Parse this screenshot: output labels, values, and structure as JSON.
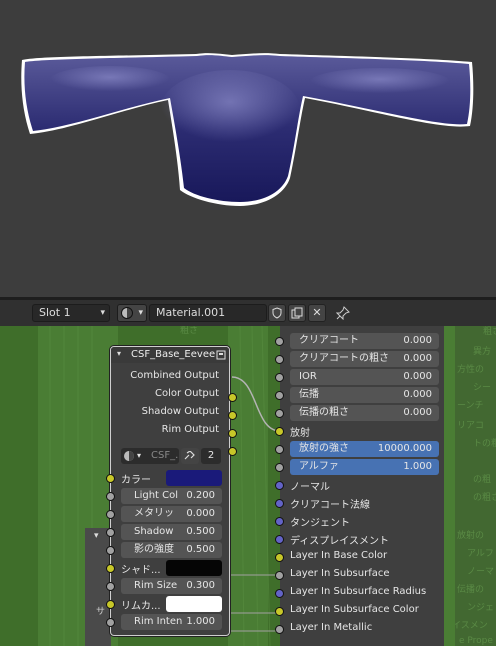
{
  "header": {
    "slot": "Slot 1",
    "material": "Material.001"
  },
  "node_left": {
    "title": "CSF_Base_Eevee",
    "outputs": [
      "Combined Output",
      "Color Output",
      "Shadow Output",
      "Rim Output"
    ],
    "group_short": "CSF_...",
    "users": "2",
    "color_label": "カラー",
    "color_swatch": "#1a1a7a",
    "light_col": {
      "label": "Light Col",
      "value": "0.200"
    },
    "metallic": {
      "label": "メタリッ",
      "value": "0.000"
    },
    "shadow": {
      "label": "Shadow",
      "value": "0.500"
    },
    "shadow_strength": {
      "label": "影の強度",
      "value": "0.500"
    },
    "shadow_color_label": "シャド...",
    "shadow_swatch": "#050505",
    "rim_size": {
      "label": "Rim Size",
      "value": "0.300"
    },
    "rim_color_label": "リムカ...",
    "rim_swatch": "#ffffff",
    "rim_intensity": {
      "label": "Rim Inten",
      "value": "1.000"
    }
  },
  "node_right": {
    "fields": [
      {
        "label": "クリアコート",
        "value": "0.000"
      },
      {
        "label": "クリアコートの粗さ",
        "value": "0.000"
      },
      {
        "label": "IOR",
        "value": "0.000"
      },
      {
        "label": "伝播",
        "value": "0.000"
      },
      {
        "label": "伝播の粗さ",
        "value": "0.000"
      }
    ],
    "emission": "放射",
    "emission_strength": {
      "label": "放射の強さ",
      "value": "10000.000"
    },
    "alpha": {
      "label": "アルファ",
      "value": "1.000"
    },
    "inputs": [
      "ノーマル",
      "クリアコート法線",
      "タンジェント",
      "ディスプレイスメント",
      "Layer In Base Color",
      "Layer In Subsurface",
      "Layer In Subsurface Radius",
      "Layer In Subsurface Color",
      "Layer In Metallic"
    ]
  },
  "background_labels": {
    "top": "粗さ",
    "frame_letter": "サ",
    "right": [
      "粗さ",
      "異方",
      "方性の",
      "シー",
      "ーンチ",
      "リアコ",
      "トの粗",
      "の粗",
      "の粗さ",
      "放射の",
      "アルフ",
      "ノーマ",
      "伝播の",
      "ンジェ",
      "スプレイスメン",
      "e Prope"
    ]
  },
  "colors": {
    "editor_bg": "#3f6e2a",
    "node_body": "#3f3f3f",
    "header_bg": "#303030",
    "accent_blue": "#4772b3",
    "socket_yellow": "#c7c729",
    "socket_grey": "#a1a1a1",
    "socket_blue": "#6363c7",
    "mesh": "#2a2a6a"
  },
  "icons": [
    "material-sphere-icon",
    "chevron-down-icon",
    "fake-user-shield-icon",
    "duplicate-icon",
    "close-icon",
    "pin-icon",
    "node-group-icon",
    "link-icon",
    "collapse-arrow-icon"
  ]
}
